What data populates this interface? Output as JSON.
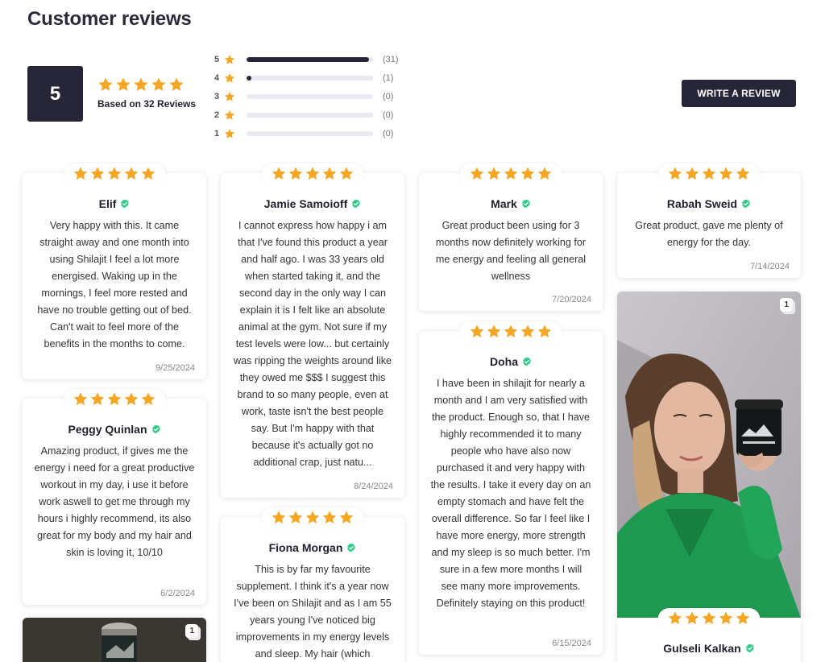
{
  "page": {
    "title": "Customer reviews"
  },
  "summary": {
    "average": "5",
    "based_on": "Based on 32 Reviews",
    "write_review_label": "WRITE A REVIEW",
    "distribution": [
      {
        "stars": "5",
        "count": "(31)",
        "fraction": 0.97
      },
      {
        "stars": "4",
        "count": "(1)",
        "fraction": 0.03
      },
      {
        "stars": "3",
        "count": "(0)",
        "fraction": 0
      },
      {
        "stars": "2",
        "count": "(0)",
        "fraction": 0
      },
      {
        "stars": "1",
        "count": "(0)",
        "fraction": 0
      }
    ]
  },
  "colors": {
    "star": "#f5a623",
    "dark": "#262638",
    "verified": "#34c98a"
  },
  "reviews": [
    {
      "name": "Elif",
      "rating": 5,
      "date": "9/25/2024",
      "text": "Very happy with this. It came straight away and one month into using Shilajit I feel a lot more energised. Waking up in the mornings, I feel more rested and have no trouble getting out of bed. Can't wait to feel more of the benefits in the months to come."
    },
    {
      "name": "Jamie Samoioff",
      "rating": 5,
      "date": "8/24/2024",
      "text": "I cannot express how happy i am that I've found this product a year and half ago. I was 33 years old when started taking it, and the second day in the only way I can explain it is I felt like an absolute animal at the gym. Not sure if my test levels were low... but certainly was ripping the weights around like they owed me $$$ I suggest this brand to so many people, even at work, taste isn't the best people say. But I'm happy with that because it's actually got no additional crap, just natu..."
    },
    {
      "name": "Mark",
      "rating": 5,
      "date": "7/20/2024",
      "text": "Great product been using for 3 months now definitely working for me energy and feeling all general wellness"
    },
    {
      "name": "Rabah Sweid",
      "rating": 5,
      "date": "7/14/2024",
      "text": "Great product, gave me plenty of energy for the day."
    },
    {
      "name": "Peggy Quinlan",
      "rating": 5,
      "date": "6/2/2024",
      "text": "Amazing product, if gives me the energy i need for a great productive workout in my day, i use it before work aswell to get me through my hours i highly recommend, its also great for my body and my hair and skin is loving it, 10/10"
    },
    {
      "name": "Doha",
      "rating": 5,
      "date": "6/15/2024",
      "text": "I have been in shilajit for nearly a month and I am very satisfied with the product. Enough so, that I have highly recommended it to many people who have also now purchased it and very happy with the results. I take it every day on an empty stomach and have felt the overall difference. So far I feel like I have more energy, more strength and my sleep is so much better. I'm sure in a few more months I will see many more improvements. Definitely staying on this product!"
    },
    {
      "name": "Fiona Morgan",
      "rating": 5,
      "date": "",
      "text": "This is by far my favourite supplement. I think it's a year now I've been on Shilajit and as I am 55 years young I've noticed big improvements in my energy levels and sleep. My hair (which"
    },
    {
      "name": "Gulseli Kalkan",
      "rating": 5,
      "date": "",
      "text": ""
    }
  ],
  "photos": [
    {
      "count": "1"
    },
    {
      "count": "1"
    }
  ]
}
